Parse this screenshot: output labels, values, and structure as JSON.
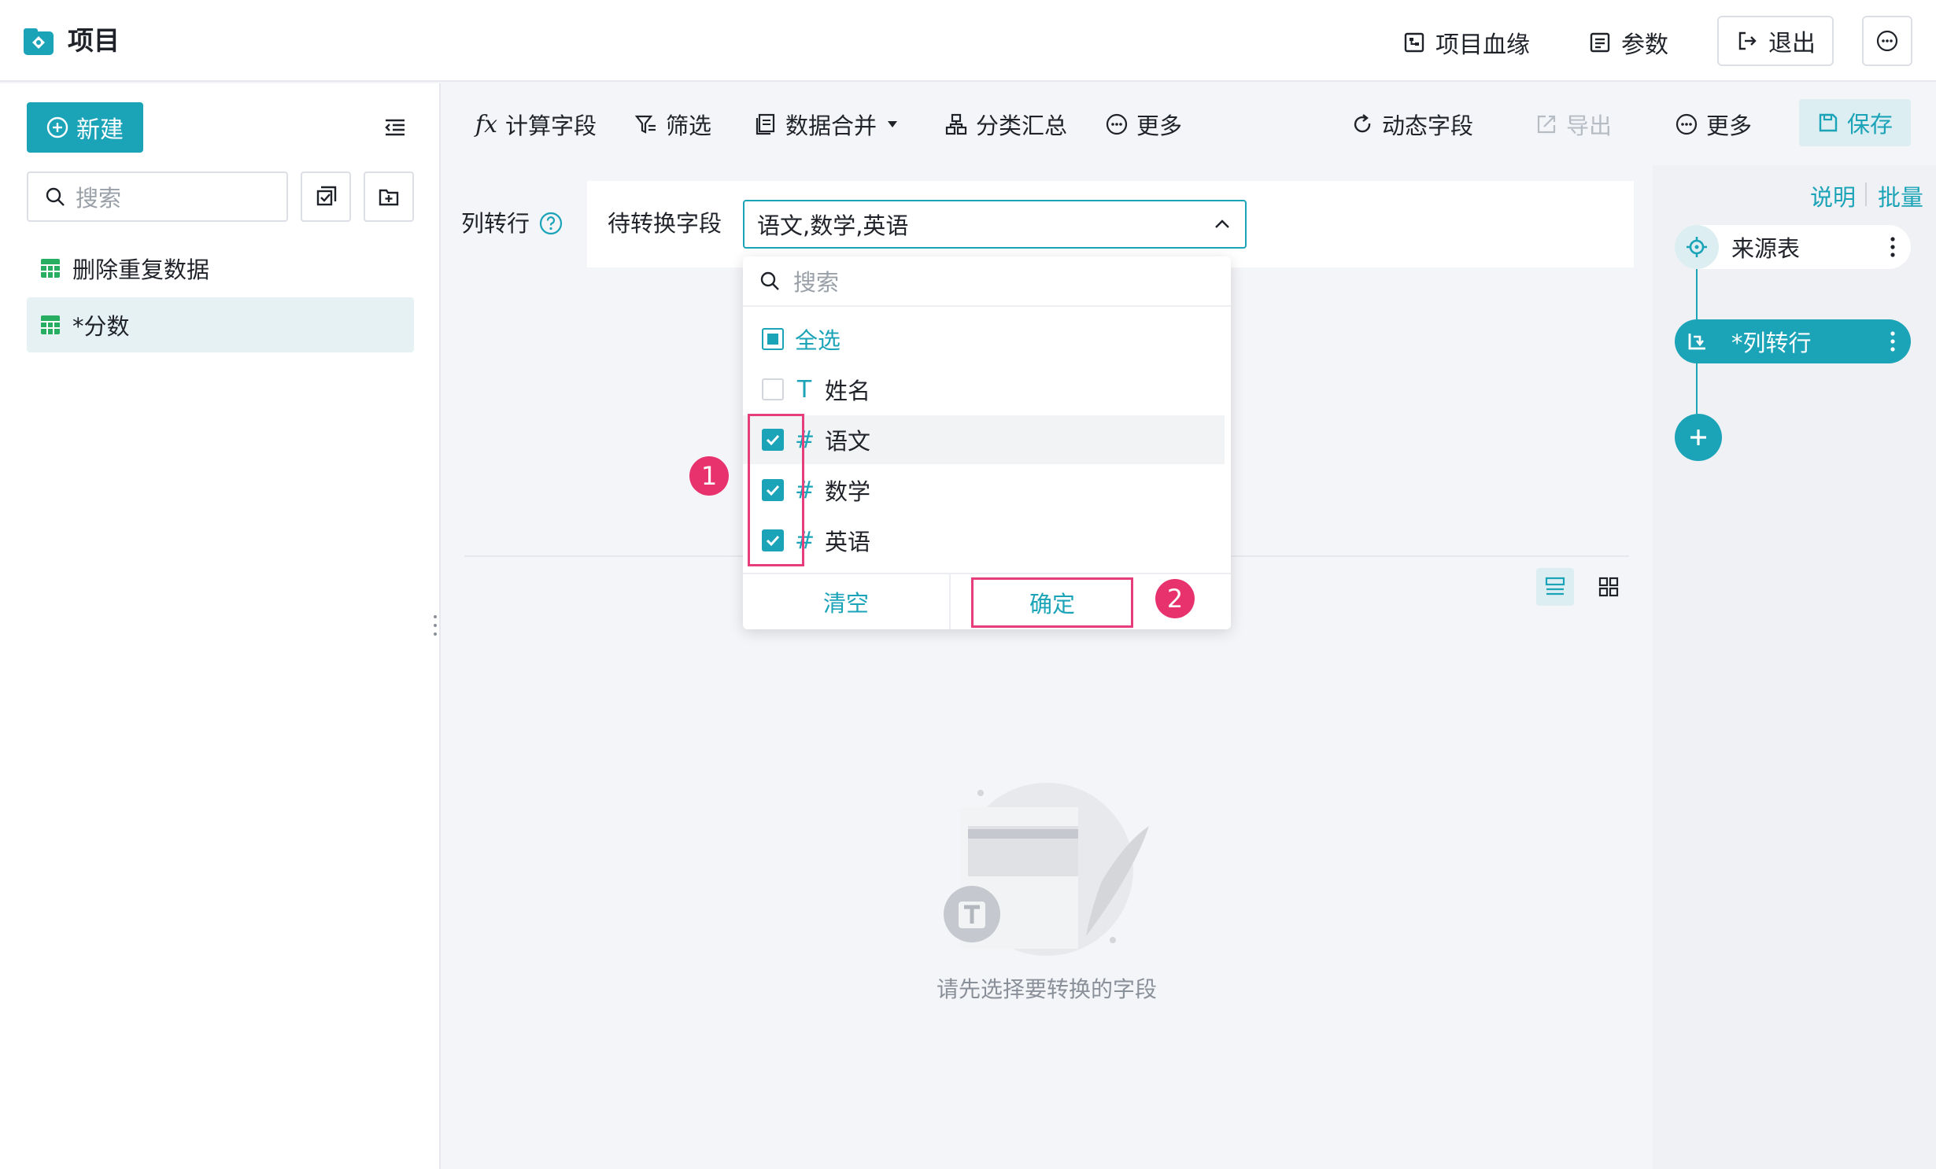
{
  "app": {
    "title": "项目"
  },
  "header": {
    "lineage_label": "项目血缘",
    "params_label": "参数",
    "logout_label": "退出"
  },
  "sidebar": {
    "new_label": "新建",
    "search_placeholder": "搜索",
    "items": [
      {
        "label": "删除重复数据"
      },
      {
        "label": "*分数"
      }
    ]
  },
  "toolbar": {
    "calc_field_label": "计算字段",
    "filter_label": "筛选",
    "merge_label": "数据合并",
    "group_summary_label": "分类汇总",
    "more_label": "更多",
    "dynamic_field_label": "动态字段",
    "export_label": "导出",
    "more2_label": "更多",
    "save_label": "保存"
  },
  "config": {
    "title": "列转行",
    "field_label": "待转换字段",
    "selected_value": "语文,数学,英语"
  },
  "dropdown": {
    "search_placeholder": "搜索",
    "select_all_label": "全选",
    "options": [
      {
        "label": "姓名",
        "type": "text",
        "checked": false
      },
      {
        "label": "语文",
        "type": "number",
        "checked": true
      },
      {
        "label": "数学",
        "type": "number",
        "checked": true
      },
      {
        "label": "英语",
        "type": "number",
        "checked": true
      }
    ],
    "clear_label": "清空",
    "confirm_label": "确定"
  },
  "annotations": {
    "step1": "1",
    "step2": "2"
  },
  "empty_state": {
    "message": "请先选择要转换的字段"
  },
  "right_panel": {
    "explain_label": "说明",
    "batch_label": "批量",
    "nodes": [
      {
        "label": "来源表"
      },
      {
        "label": "*列转行"
      }
    ]
  },
  "colors": {
    "accent": "#1ba3b8",
    "annotation": "#e8326e"
  }
}
